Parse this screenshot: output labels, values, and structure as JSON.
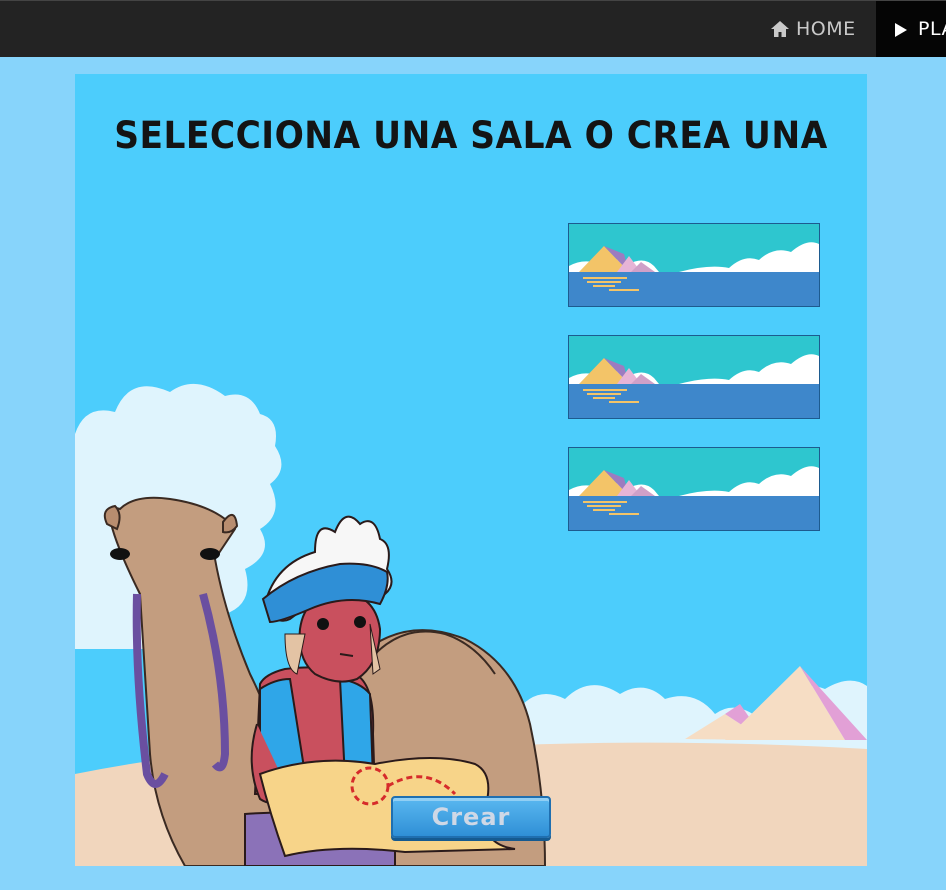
{
  "nav": {
    "home_label": "HOME",
    "play_label": "PLAY"
  },
  "game": {
    "title": "SELECCIONA UNA SALA O CREA UNA",
    "rooms": [
      {
        "icon": "pyramids-thumbnail"
      },
      {
        "icon": "pyramids-thumbnail"
      },
      {
        "icon": "pyramids-thumbnail"
      }
    ],
    "create_label": "Crear"
  },
  "colors": {
    "topbar": "#232323",
    "page_bg": "#87d4fb",
    "game_sky": "#4ccdfc",
    "sand": "#f1d6bd",
    "pyramid": "#e2a0d6"
  }
}
